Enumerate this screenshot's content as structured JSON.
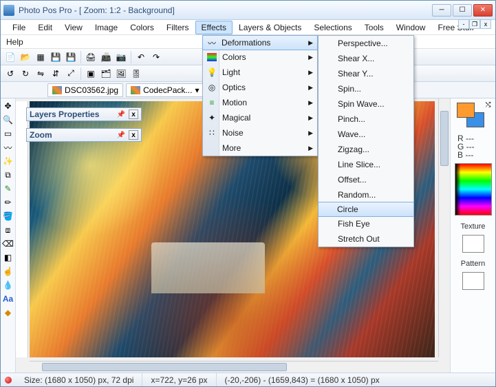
{
  "title": "Photo Pos Pro - [ Zoom: 1:2 - Background]",
  "menu": {
    "file": "File",
    "edit": "Edit",
    "view": "View",
    "image": "Image",
    "colors": "Colors",
    "filters": "Filters",
    "effects": "Effects",
    "layers": "Layers & Objects",
    "selections": "Selections",
    "tools": "Tools",
    "window": "Window",
    "free": "Free Stuff",
    "help": "Help"
  },
  "tabs": {
    "t1": "DSC03562.jpg",
    "t2": "CodecPack..."
  },
  "panels": {
    "layers": "Layers Properties",
    "zoom": "Zoom"
  },
  "effects_menu": {
    "deformations": "Deformations",
    "colors": "Colors",
    "light": "Light",
    "optics": "Optics",
    "motion": "Motion",
    "magical": "Magical",
    "noise": "Noise",
    "more": "More"
  },
  "deform_menu": {
    "perspective": "Perspective...",
    "shearx": "Shear X...",
    "sheary": "Shear Y...",
    "spin": "Spin...",
    "spinwave": "Spin Wave...",
    "pinch": "Pinch...",
    "wave": "Wave...",
    "zigzag": "Zigzag...",
    "lineslice": "Line Slice...",
    "offset": "Offset...",
    "random": "Random...",
    "circle": "Circle",
    "fisheye": "Fish Eye",
    "stretch": "Stretch Out"
  },
  "right": {
    "r": "R ---",
    "g": "G ---",
    "b": "B ---",
    "texture": "Texture",
    "pattern": "Pattern"
  },
  "status": {
    "size": "Size: (1680 x 1050) px, 72 dpi",
    "pos": "x=722, y=26 px",
    "sel": "(-20,-206) - (1659,843) = (1680 x 1050) px"
  }
}
